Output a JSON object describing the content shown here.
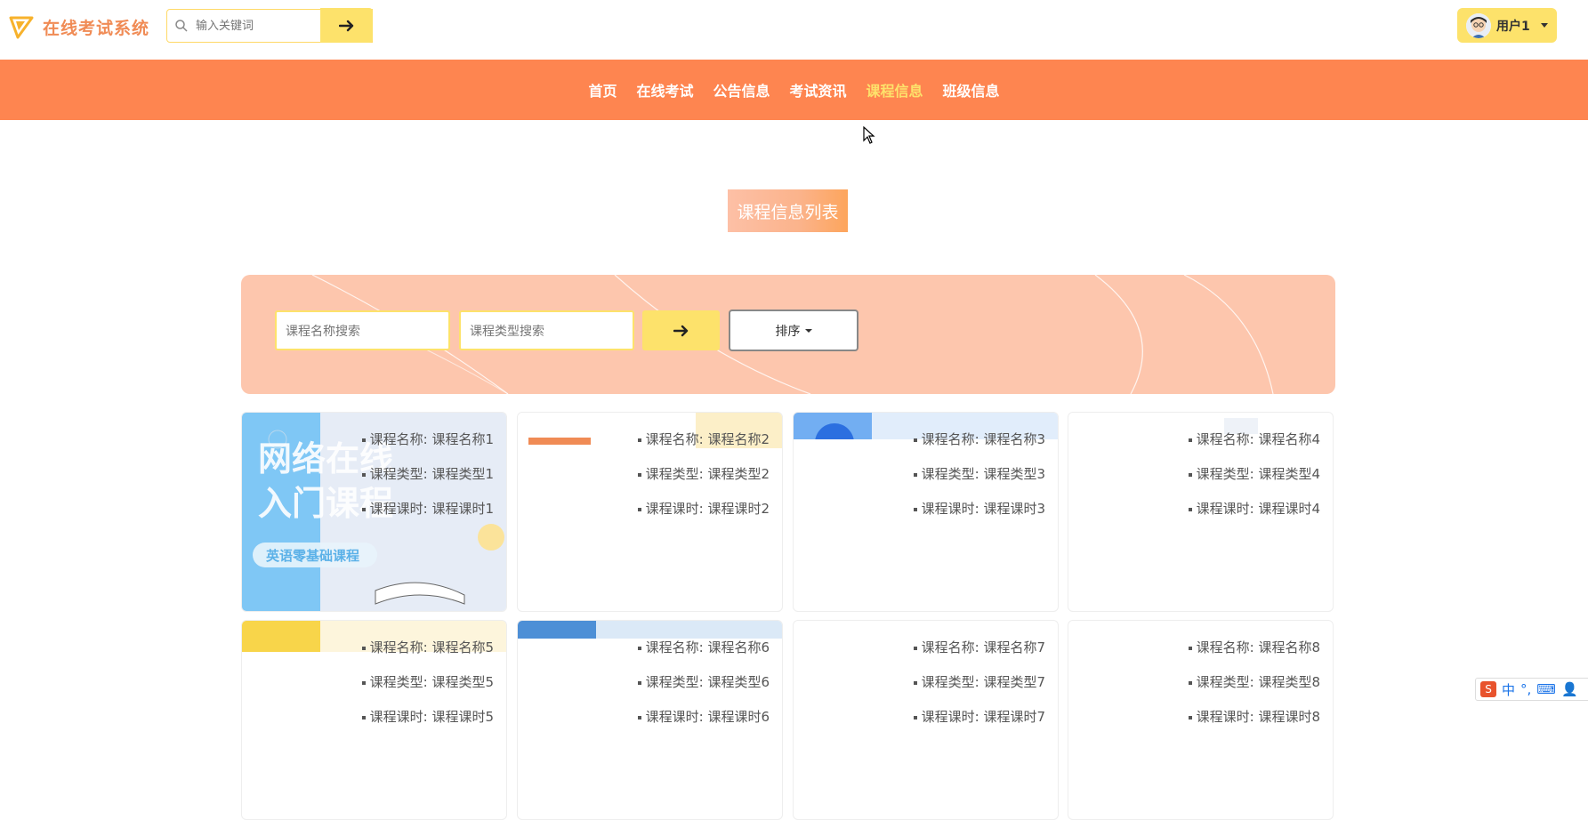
{
  "header": {
    "logo_text": "在线考试系统",
    "search_placeholder": "输入关键词",
    "user_label": "用户1"
  },
  "nav": {
    "items": [
      {
        "label": "首页",
        "active": false
      },
      {
        "label": "在线考试",
        "active": false
      },
      {
        "label": "公告信息",
        "active": false
      },
      {
        "label": "考试资讯",
        "active": false
      },
      {
        "label": "课程信息",
        "active": true
      },
      {
        "label": "班级信息",
        "active": false
      }
    ]
  },
  "page_title": "课程信息列表",
  "filters": {
    "name_placeholder": "课程名称搜索",
    "type_placeholder": "课程类型搜索",
    "sort_label": "排序"
  },
  "card_labels": {
    "name": "课程名称",
    "type": "课程类型",
    "hours": "课程课时"
  },
  "courses": [
    {
      "name": "课程名称1",
      "type": "课程类型1",
      "hours": "课程课时1",
      "thumb_text1": "网络在线",
      "thumb_text2": "入门课程",
      "thumb_text3": "英语零基础课程"
    },
    {
      "name": "课程名称2",
      "type": "课程类型2",
      "hours": "课程课时2"
    },
    {
      "name": "课程名称3",
      "type": "课程类型3",
      "hours": "课程课时3"
    },
    {
      "name": "课程名称4",
      "type": "课程类型4",
      "hours": "课程课时4"
    },
    {
      "name": "课程名称5",
      "type": "课程类型5",
      "hours": "课程课时5"
    },
    {
      "name": "课程名称6",
      "type": "课程类型6",
      "hours": "课程课时6"
    },
    {
      "name": "课程名称7",
      "type": "课程类型7",
      "hours": "课程课时7"
    },
    {
      "name": "课程名称8",
      "type": "课程类型8",
      "hours": "课程课时8"
    }
  ],
  "ime_bar": {
    "mode": "中"
  },
  "colors": {
    "nav_bg": "#fe8550",
    "accent_yellow": "#fde26b",
    "logo_orange": "#f08b55",
    "panel_bg": "#fdc6ad"
  }
}
